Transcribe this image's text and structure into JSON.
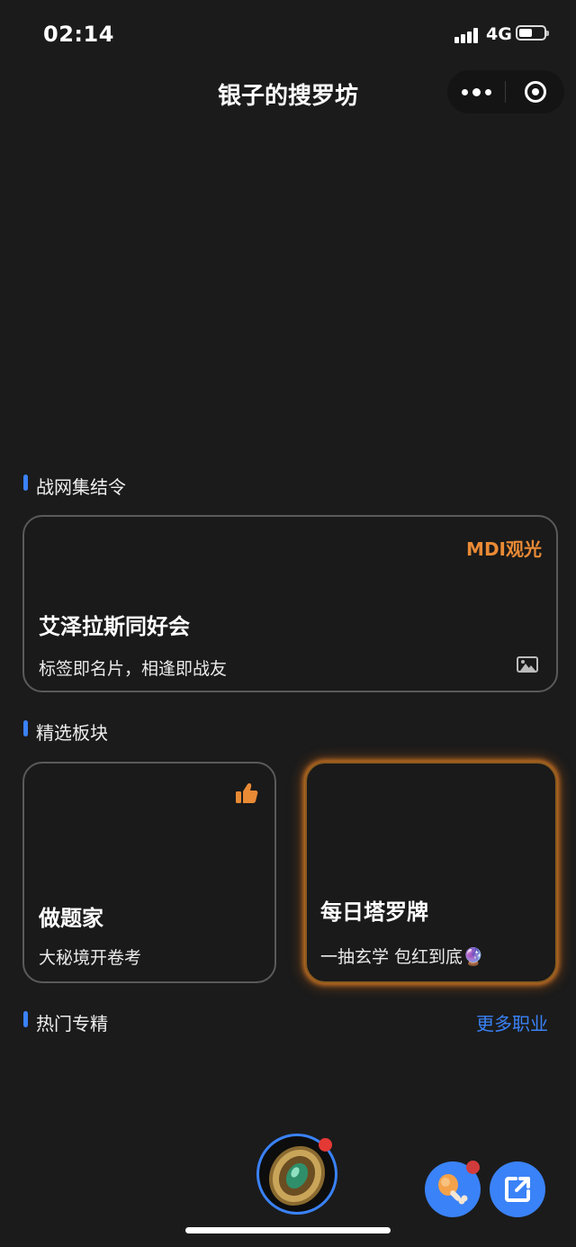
{
  "status_bar": {
    "time": "02:14",
    "network": "4G"
  },
  "nav": {
    "title": "银子的搜罗坊"
  },
  "sections": {
    "battle_net": {
      "label": "战网集结令"
    },
    "featured": {
      "label": "精选板块"
    },
    "hot_specs": {
      "label": "热门专精",
      "more": "更多职业"
    }
  },
  "cards": {
    "guild": {
      "badge": "MDI观光",
      "title": "艾泽拉斯同好会",
      "subtitle": "标签即名片，相逢即战友"
    },
    "quiz": {
      "title": "做题家",
      "subtitle": "大秘境开卷考"
    },
    "tarot": {
      "title": "每日塔罗牌",
      "subtitle": "一抽玄学 包红到底🔮"
    }
  },
  "colors": {
    "background": "#1b1b1b",
    "accent_blue": "#3a82f7",
    "accent_orange": "#e98a35",
    "notification_red": "#e53935"
  },
  "icons": [
    "more-dots-icon",
    "target-icon",
    "image-icon",
    "thumbs-up-icon",
    "drumstick-icon",
    "share-icon",
    "coin-avatar-icon"
  ]
}
